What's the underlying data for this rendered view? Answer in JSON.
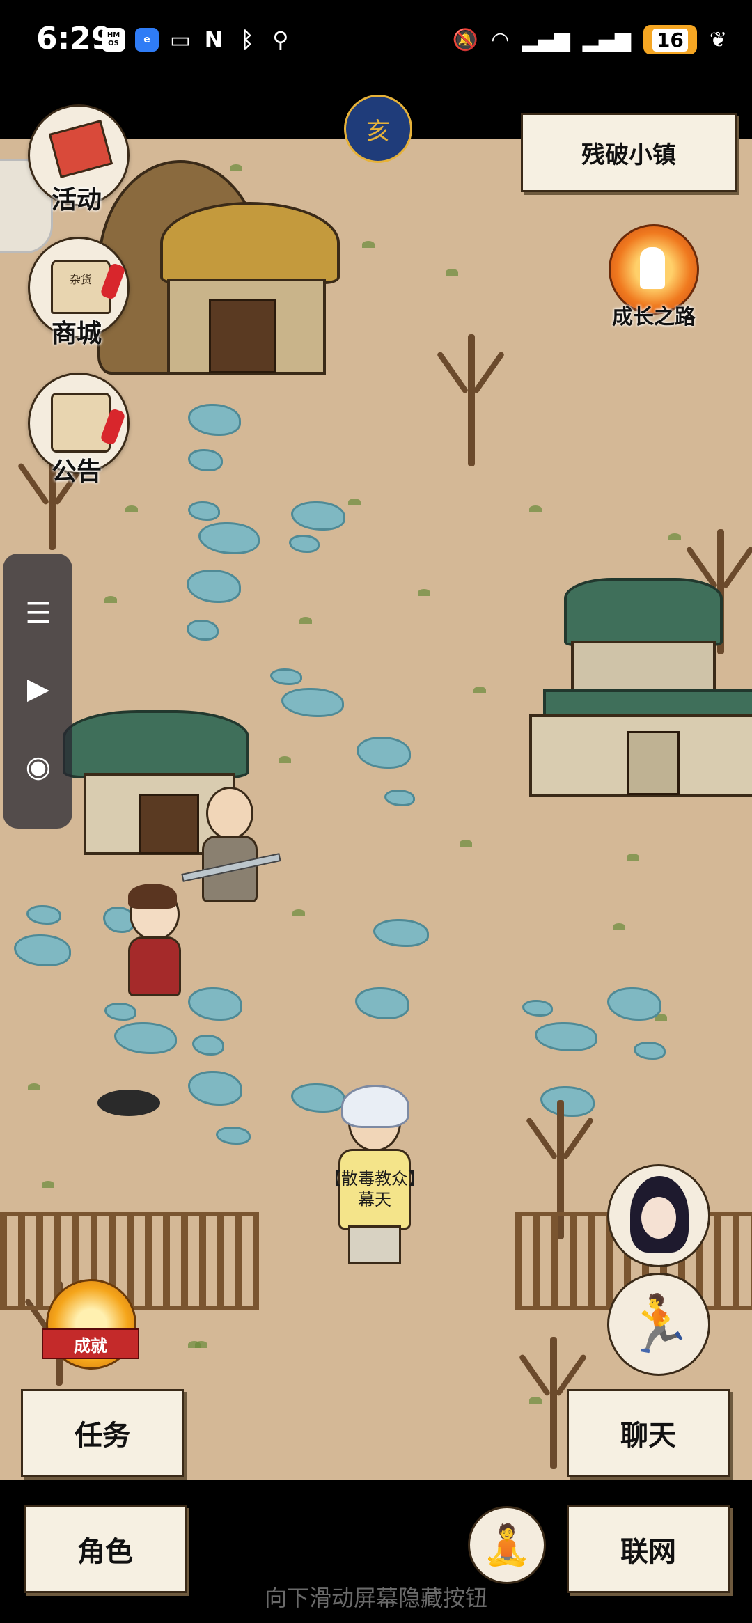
{
  "status_bar": {
    "time": "6:29",
    "left_icons": [
      "HM OS",
      "browser-icon",
      "cast-icon",
      "nfc-icon",
      "bluetooth-icon",
      "location-icon"
    ],
    "battery": "16"
  },
  "hud": {
    "moon_glyph": "亥",
    "location": "残破小镇",
    "left_menu": [
      {
        "label": "活动"
      },
      {
        "label": "商城"
      },
      {
        "label": "公告"
      }
    ],
    "growth_label": "成长之路",
    "achievement_label": "成就",
    "shop_sign_text": "杂货"
  },
  "npc": {
    "title_line1": "【散毒教众】",
    "title_line2": "幕天"
  },
  "buttons": {
    "task": "任务",
    "chat": "聊天",
    "character": "角色",
    "network": "联网"
  },
  "hint": "向下滑动屏幕隐藏按钮",
  "colors": {
    "ground": "#d4b896",
    "button_bg": "#f6f0e2",
    "ink": "#3a2a18"
  }
}
